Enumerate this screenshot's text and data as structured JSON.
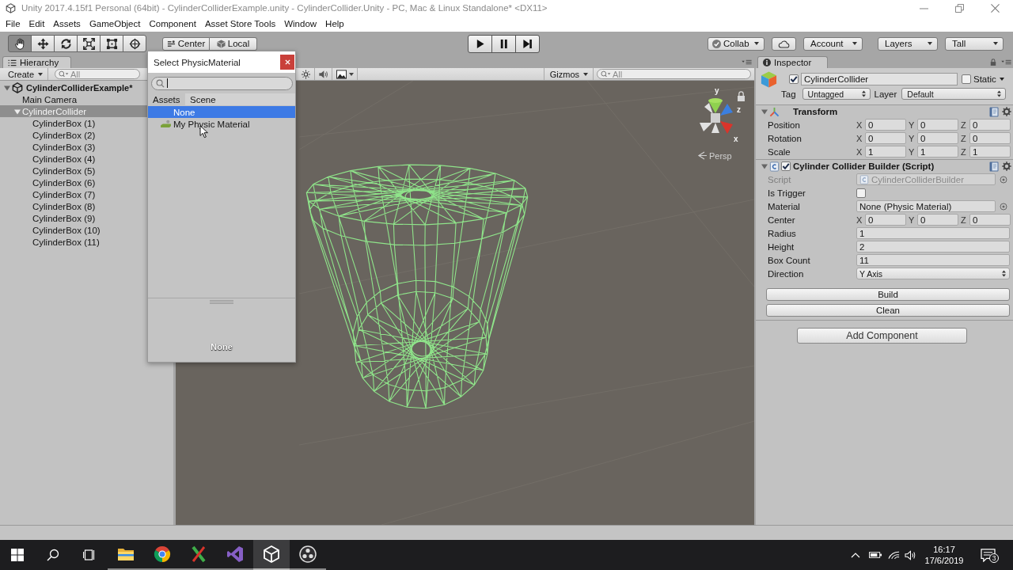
{
  "window": {
    "title": "Unity 2017.4.15f1 Personal (64bit) - CylinderColliderExample.unity - CylinderCollider.Unity - PC, Mac & Linux Standalone* <DX11>"
  },
  "menu": [
    "File",
    "Edit",
    "Assets",
    "GameObject",
    "Component",
    "Asset Store Tools",
    "Window",
    "Help"
  ],
  "toolbar": {
    "tools": [
      {
        "selected": true
      },
      {
        "selected": false
      },
      {
        "selected": false
      },
      {
        "selected": false
      },
      {
        "selected": false
      },
      {
        "selected": false
      }
    ],
    "pivot_mode": "Center",
    "pivot_rotation": "Local",
    "collab": "Collab",
    "account": "Account",
    "layers": "Layers",
    "layout": "Tall"
  },
  "hierarchy": {
    "tab": "Hierarchy",
    "create": "Create",
    "search": {
      "placeholder": "All"
    },
    "tree": [
      {
        "kind": "scene",
        "label": "CylinderColliderExample*",
        "selected": false,
        "expanded": true,
        "children": [
          {
            "label": "Main Camera",
            "selected": false
          },
          {
            "label": "CylinderCollider",
            "selected": true,
            "expanded": true,
            "children": [
              {
                "label": "CylinderBox (1)",
                "selected": false
              },
              {
                "label": "CylinderBox (2)",
                "selected": false
              },
              {
                "label": "CylinderBox (3)",
                "selected": false
              },
              {
                "label": "CylinderBox (4)",
                "selected": false
              },
              {
                "label": "CylinderBox (5)",
                "selected": false
              },
              {
                "label": "CylinderBox (6)",
                "selected": false
              },
              {
                "label": "CylinderBox (7)",
                "selected": false
              },
              {
                "label": "CylinderBox (8)",
                "selected": false
              },
              {
                "label": "CylinderBox (9)",
                "selected": false
              },
              {
                "label": "CylinderBox (10)",
                "selected": false
              },
              {
                "label": "CylinderBox (11)",
                "selected": false
              }
            ]
          }
        ]
      }
    ]
  },
  "scene_view": {
    "lighting_on": false,
    "audio_on": false,
    "gizmos": "Gizmos",
    "search": {
      "placeholder": "All"
    },
    "axes": [
      "y",
      "z",
      "x"
    ],
    "projection": "Persp"
  },
  "object_picker": {
    "title": "Select PhysicMaterial",
    "tabs": [
      {
        "label": "Assets",
        "selected": true
      },
      {
        "label": "Scene",
        "selected": false
      }
    ],
    "items": [
      {
        "kind": "none",
        "label": "None",
        "selected": true
      },
      {
        "kind": "asset",
        "label": "My Physic Material",
        "selected": false
      }
    ],
    "preview": "None"
  },
  "inspector": {
    "tab": "Inspector",
    "object": {
      "active": true,
      "name": "CylinderCollider",
      "static": {
        "label": "Static",
        "checked": false
      },
      "tag": {
        "label": "Tag",
        "value": "Untagged"
      },
      "layer": {
        "label": "Layer",
        "value": "Default"
      }
    },
    "components": [
      {
        "kind": "transform",
        "title": "Transform",
        "expanded": true,
        "fields": [
          {
            "kind": "vector",
            "label": "Position",
            "values": [
              {
                "axis": "X",
                "value": "0"
              },
              {
                "axis": "Y",
                "value": "0"
              },
              {
                "axis": "Z",
                "value": "0"
              }
            ]
          },
          {
            "kind": "vector",
            "label": "Rotation",
            "values": [
              {
                "axis": "X",
                "value": "0"
              },
              {
                "axis": "Y",
                "value": "0"
              },
              {
                "axis": "Z",
                "value": "0"
              }
            ]
          },
          {
            "kind": "vector",
            "label": "Scale",
            "values": [
              {
                "axis": "X",
                "value": "1"
              },
              {
                "axis": "Y",
                "value": "1"
              },
              {
                "axis": "Z",
                "value": "1"
              }
            ]
          }
        ]
      },
      {
        "kind": "script",
        "title": "Cylinder Collider Builder (Script)",
        "expanded": true,
        "enabled": true,
        "fields": [
          {
            "kind": "script",
            "label": "Script",
            "value": "CylinderColliderBuilder",
            "disabled": true
          },
          {
            "kind": "checkbox",
            "label": "Is Trigger",
            "checked": false
          },
          {
            "kind": "object",
            "label": "Material",
            "value": "None (Physic Material)",
            "disabled": false
          },
          {
            "kind": "vector",
            "label": "Center",
            "values": [
              {
                "axis": "X",
                "value": "0"
              },
              {
                "axis": "Y",
                "value": "0"
              },
              {
                "axis": "Z",
                "value": "0"
              }
            ]
          },
          {
            "kind": "number",
            "label": "Radius",
            "value": "1"
          },
          {
            "kind": "number",
            "label": "Height",
            "value": "2"
          },
          {
            "kind": "number",
            "label": "Box Count",
            "value": "11"
          },
          {
            "kind": "dropdown",
            "label": "Direction",
            "value": "Y Axis"
          }
        ],
        "buttons": [
          "Build",
          "Clean"
        ]
      }
    ],
    "add_component": "Add Component"
  },
  "taskbar": {
    "apps": [
      {
        "selected": false
      },
      {
        "selected": false
      },
      {
        "selected": false
      },
      {
        "selected": false
      },
      {
        "selected": true
      },
      {
        "selected": false
      }
    ],
    "time": "16:17",
    "date": "17/6/2019",
    "notifications": "3"
  }
}
